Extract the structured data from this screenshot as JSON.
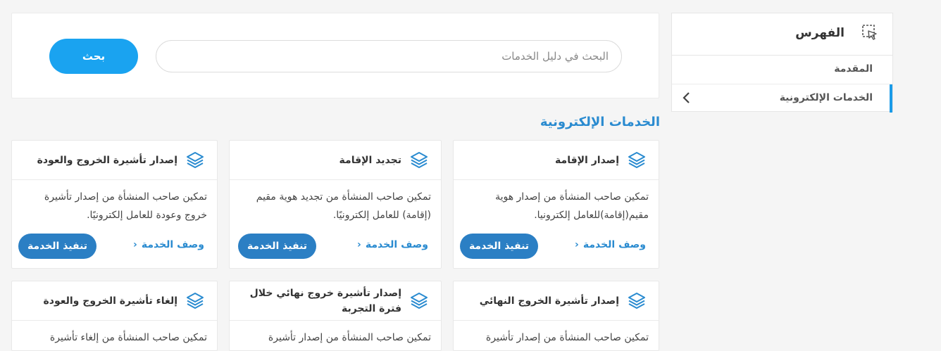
{
  "sidebar": {
    "title": "الفهرس",
    "items": [
      {
        "label": "المقدمة"
      },
      {
        "label": "الخدمات الإلكترونية"
      }
    ]
  },
  "search": {
    "placeholder": "البحث في دليل الخدمات",
    "button_label": "بحث"
  },
  "section": {
    "title": "الخدمات الإلكترونية"
  },
  "cards": [
    {
      "title": "إصدار الإقامة",
      "description": "تمكين صاحب المنشأة من إصدار هوية مقيم(إقامة)للعامل إلكترونيا.",
      "link_label": "وصف الخدمة",
      "button_label": "تنفيذ الخدمة"
    },
    {
      "title": "تجديد الإقامة",
      "description": "تمكين صاحب المنشأة من تجديد هوية مقيم (إقامة) للعامل إلكترونيًا.",
      "link_label": "وصف الخدمة",
      "button_label": "تنفيذ الخدمة"
    },
    {
      "title": "إصدار تأشيرة الخروج والعودة",
      "description": "تمكين صاحب المنشأة من إصدار تأشيرة خروج وعودة للعامل إلكترونيًا.",
      "link_label": "وصف الخدمة",
      "button_label": "تنفيذ الخدمة"
    },
    {
      "title": "إصدار تأشيرة الخروج النهائي",
      "description": "تمكين صاحب المنشأة من إصدار تأشيرة"
    },
    {
      "title": "إصدار تأشيرة خروج نهائي خلال فترة التجربة",
      "description": "تمكين صاحب المنشأة من إصدار تأشيرة"
    },
    {
      "title": "إلغاء تأشيرة الخروج والعودة",
      "description": "تمكين صاحب المنشأة من إلغاء تأشيرة"
    }
  ]
}
